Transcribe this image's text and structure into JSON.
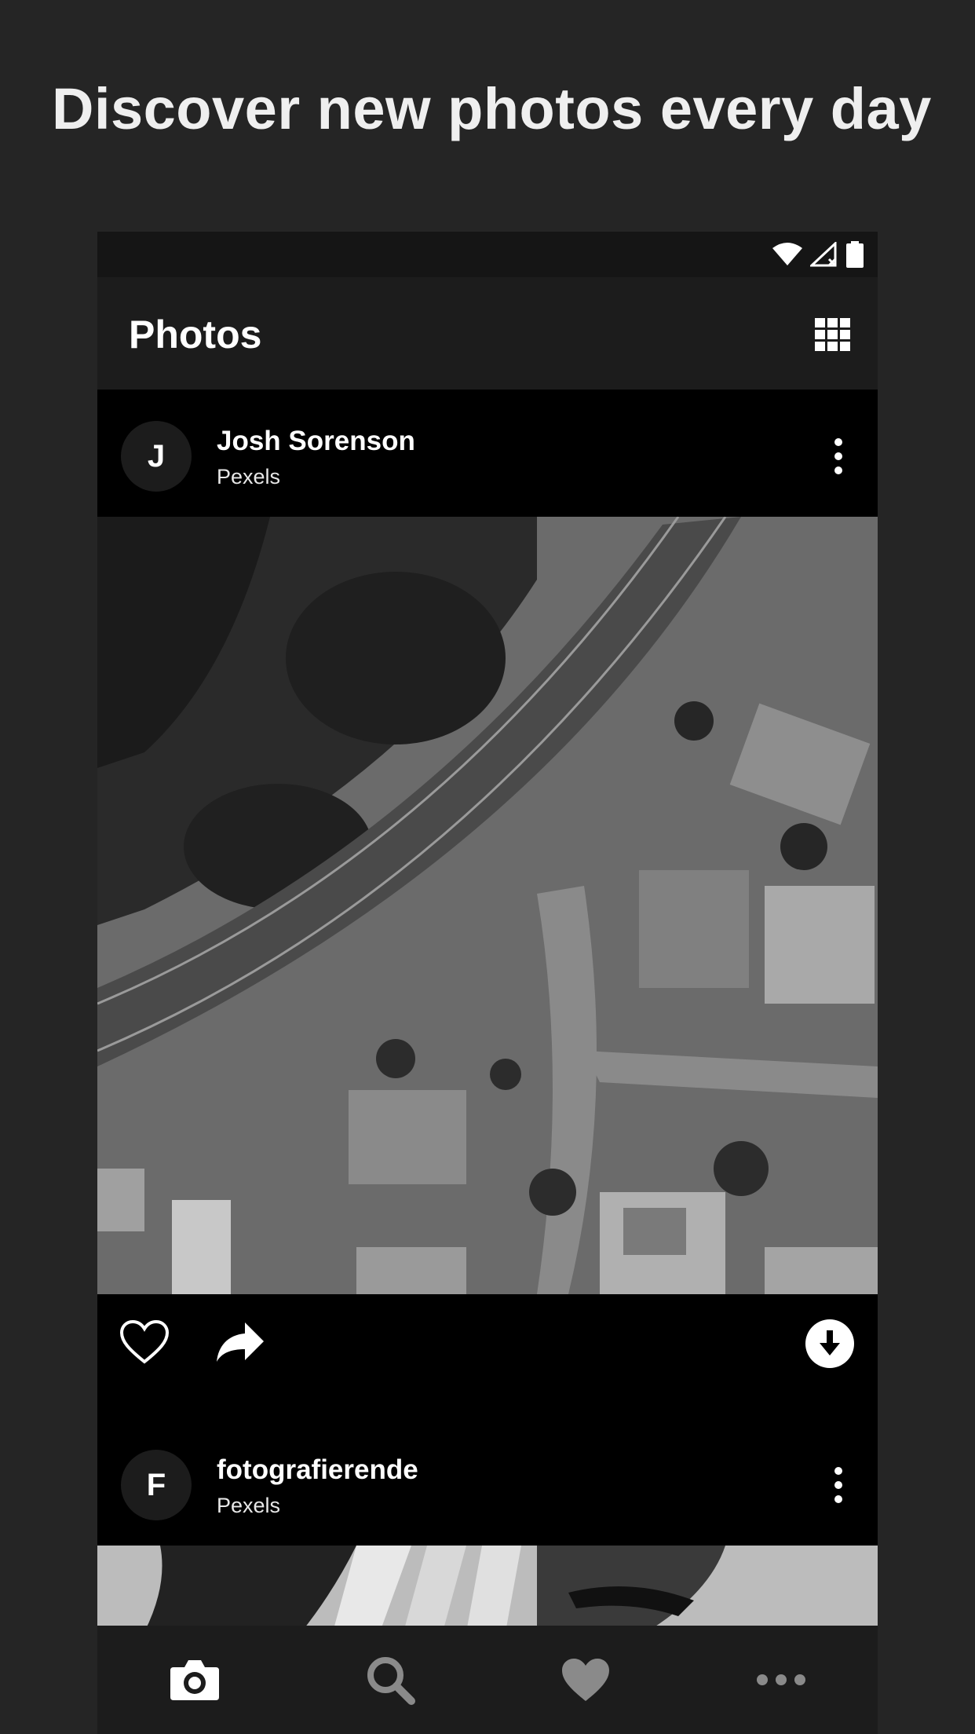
{
  "promo": {
    "title": "Discover new photos every day"
  },
  "app_bar": {
    "title": "Photos",
    "grid_icon": "grid-view-icon"
  },
  "status_bar": {
    "icons": [
      "wifi-icon",
      "cellular-signal-icon",
      "battery-icon"
    ]
  },
  "posts": [
    {
      "avatar_letter": "J",
      "author": "Josh Sorenson",
      "source": "Pexels"
    },
    {
      "avatar_letter": "F",
      "author": "fotografierende",
      "source": "Pexels"
    }
  ],
  "post_actions": [
    "heart-icon",
    "share-icon",
    "download-icon"
  ],
  "bottom_nav": [
    "camera-icon",
    "search-icon",
    "favorites-icon",
    "more-icon"
  ],
  "colors": {
    "background": "#252525",
    "bar": "#1c1c1c",
    "feed": "#000000",
    "text": "#ffffff"
  }
}
